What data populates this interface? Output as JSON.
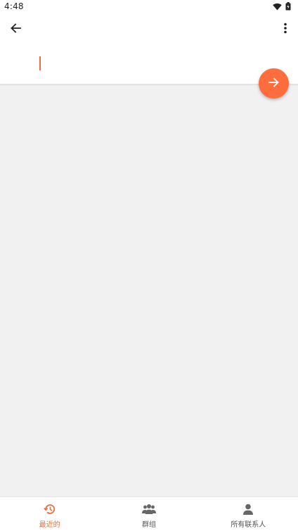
{
  "status_bar": {
    "time": "4:48",
    "icons": [
      "wifi-icon",
      "battery-icon"
    ]
  },
  "toolbar": {
    "back_icon": "arrow-left-icon",
    "menu_icon": "more-vert-icon"
  },
  "input": {
    "value": "",
    "placeholder": ""
  },
  "fab": {
    "icon": "arrow-right-icon",
    "color": "#ff6d3f"
  },
  "bottom_nav": {
    "tabs": [
      {
        "label": "最近的",
        "icon": "history-icon",
        "active": true
      },
      {
        "label": "群组",
        "icon": "group-icon",
        "active": false
      },
      {
        "label": "所有联系人",
        "icon": "person-icon",
        "active": false
      }
    ]
  },
  "colors": {
    "accent": "#f26b3a",
    "background": "#f1f1f1",
    "surface": "#ffffff",
    "inactive_icon": "#666666"
  }
}
